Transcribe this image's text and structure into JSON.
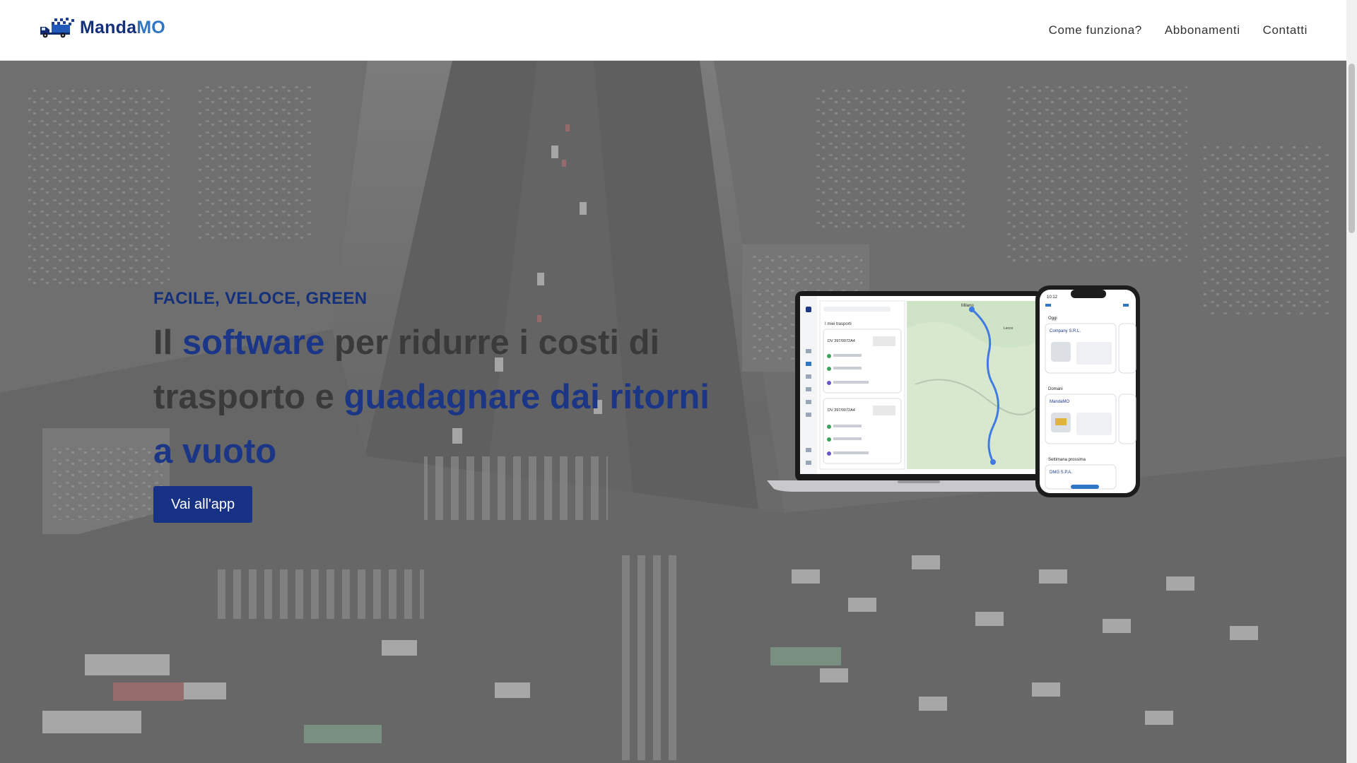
{
  "navbar": {
    "brand": {
      "part_a": "Manda",
      "part_b": "MO",
      "logo_icon": "delivery-truck-icon"
    },
    "links": [
      {
        "label": "Come funziona?"
      },
      {
        "label": "Abbonamenti"
      },
      {
        "label": "Contatti"
      }
    ]
  },
  "hero": {
    "tagline": "FACILE, VELOCE, GREEN",
    "headline": {
      "w1": "Il",
      "w2": "software",
      "w3": "per ridurre i costi di trasporto e",
      "w4": "guadagnare dai ritorni a vuoto"
    },
    "cta_label": "Vai all'app",
    "background": "aerial-city-traffic-night-photo",
    "devices_image": "laptop-and-phone-mockup"
  },
  "mockup": {
    "laptop": {
      "panel_title": "I miei trasporti",
      "card_code_1": "DV 397/0072A4",
      "card_code_2": "DV 397/0072A4",
      "map_place_1": "Milano",
      "map_place_2": "Lecco"
    },
    "phone": {
      "time": "10:12",
      "section_today": "Oggi",
      "card_company": "Company S.R.L.",
      "section_tomorrow": "Domani",
      "card_mandamo": "MandaMO",
      "section_next_week": "Settimana prossima",
      "card_dmg": "DMG S.P.A."
    }
  },
  "colors": {
    "brand_dark": "#14307a",
    "brand_light": "#2f76c4",
    "cta_bg": "#173184",
    "headline_gray": "#3a3a3a"
  }
}
